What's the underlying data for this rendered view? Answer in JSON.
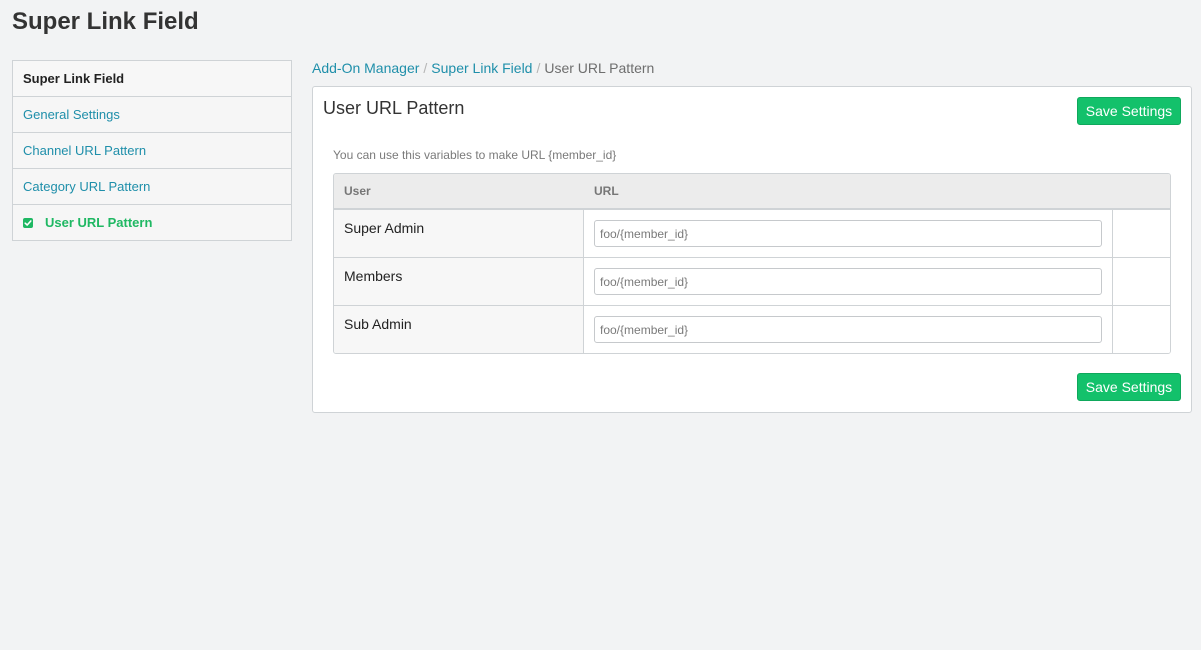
{
  "app": {
    "title": "Super Link Field"
  },
  "sidebar": {
    "heading": "Super Link Field",
    "items": [
      {
        "label": "General Settings"
      },
      {
        "label": "Channel URL Pattern"
      },
      {
        "label": "Category URL Pattern"
      },
      {
        "label": "User URL Pattern",
        "active": true,
        "icon": "check-square-icon"
      }
    ]
  },
  "breadcrumb": {
    "items": [
      "Add-On Manager",
      "Super Link Field"
    ],
    "current": "User URL Pattern",
    "separator": "/"
  },
  "panel": {
    "title": "User URL Pattern",
    "save_label": "Save Settings",
    "hint": "You can use this variables to make URL {member_id}",
    "table": {
      "headers": [
        "User",
        "URL"
      ],
      "rows": [
        {
          "user": "Super Admin",
          "url_placeholder": "foo/{member_id}"
        },
        {
          "user": "Members",
          "url_placeholder": "foo/{member_id}"
        },
        {
          "user": "Sub Admin",
          "url_placeholder": "foo/{member_id}"
        }
      ]
    }
  },
  "colors": {
    "accent_link": "#1f8faa",
    "active_green": "#1fb863",
    "button_green": "#13c16b"
  }
}
